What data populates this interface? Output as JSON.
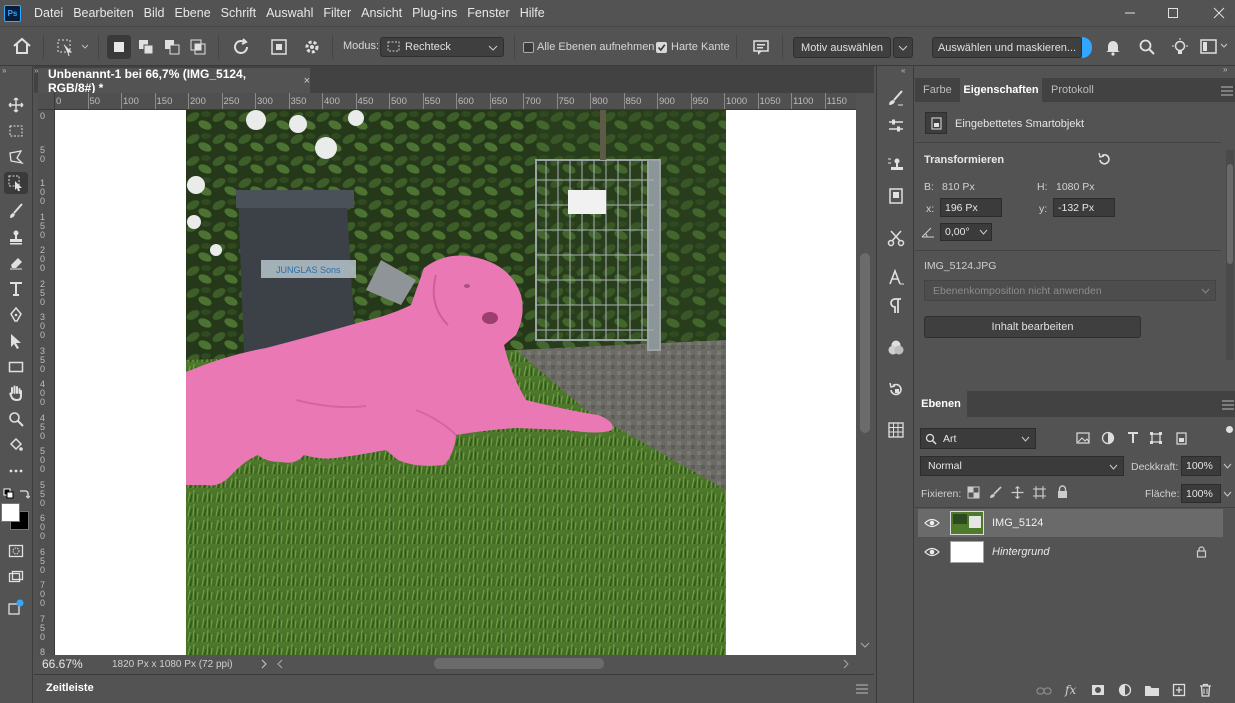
{
  "app": {
    "logo": "Ps"
  },
  "menu": [
    "Datei",
    "Bearbeiten",
    "Bild",
    "Ebene",
    "Schrift",
    "Auswahl",
    "Filter",
    "Ansicht",
    "Plug-ins",
    "Fenster",
    "Hilfe"
  ],
  "options": {
    "mode_label": "Modus:",
    "mode_value": "Rechteck",
    "all_layers": "Alle Ebenen aufnehmen",
    "hard_edge": "Harte Kante",
    "select_subject": "Motiv auswählen",
    "select_mask": "Auswählen und maskieren..."
  },
  "document": {
    "tab_title": "Unbenannt-1 bei 66,7% (IMG_5124, RGB/8#) *",
    "zoom": "66.67%",
    "dimensions": "1820 Px x 1080 Px (72 ppi)"
  },
  "ruler": {
    "top": [
      "0",
      "50",
      "100",
      "150",
      "200",
      "250",
      "300",
      "350",
      "400",
      "450",
      "500",
      "550",
      "600",
      "650",
      "700",
      "750",
      "800",
      "850",
      "900",
      "950",
      "1000",
      "1050",
      "1100",
      "1150"
    ],
    "left": [
      "0",
      "5 0",
      "1 0 0",
      "1 5 0",
      "2 0 0",
      "2 5 0",
      "3 0 0",
      "3 5 0",
      "4 0 0",
      "4 5 0",
      "5 0 0",
      "5 5 0",
      "6 0 0",
      "6 5 0",
      "7 0 0",
      "7 5 0",
      "8 0 0"
    ]
  },
  "photo": {
    "sign_text": "JUNGLAS Sons"
  },
  "timeline": {
    "label": "Zeitleiste"
  },
  "properties": {
    "tabs": [
      "Farbe",
      "Eigenschaften",
      "Protokoll"
    ],
    "object_type": "Eingebettetes Smartobjekt",
    "section": "Transformieren",
    "w_label": "B:",
    "w_value": "810 Px",
    "h_label": "H:",
    "h_value": "1080 Px",
    "x_label": "x:",
    "x_value": "196 Px",
    "y_label": "y:",
    "y_value": "-132 Px",
    "angle_value": "0,00°",
    "file_name": "IMG_5124.JPG",
    "comp_placeholder": "Ebenenkomposition nicht anwenden",
    "edit_button": "Inhalt bearbeiten"
  },
  "layers": {
    "tab": "Ebenen",
    "filter_value": "Art",
    "blend_mode": "Normal",
    "opacity_label": "Deckkraft:",
    "opacity_value": "100%",
    "lock_label": "Fixieren:",
    "fill_label": "Fläche:",
    "fill_value": "100%",
    "items": [
      {
        "name": "IMG_5124"
      },
      {
        "name": "Hintergrund"
      }
    ]
  },
  "colors": {
    "accent": "#31a8ff",
    "mask_pink": "#e978b4"
  }
}
